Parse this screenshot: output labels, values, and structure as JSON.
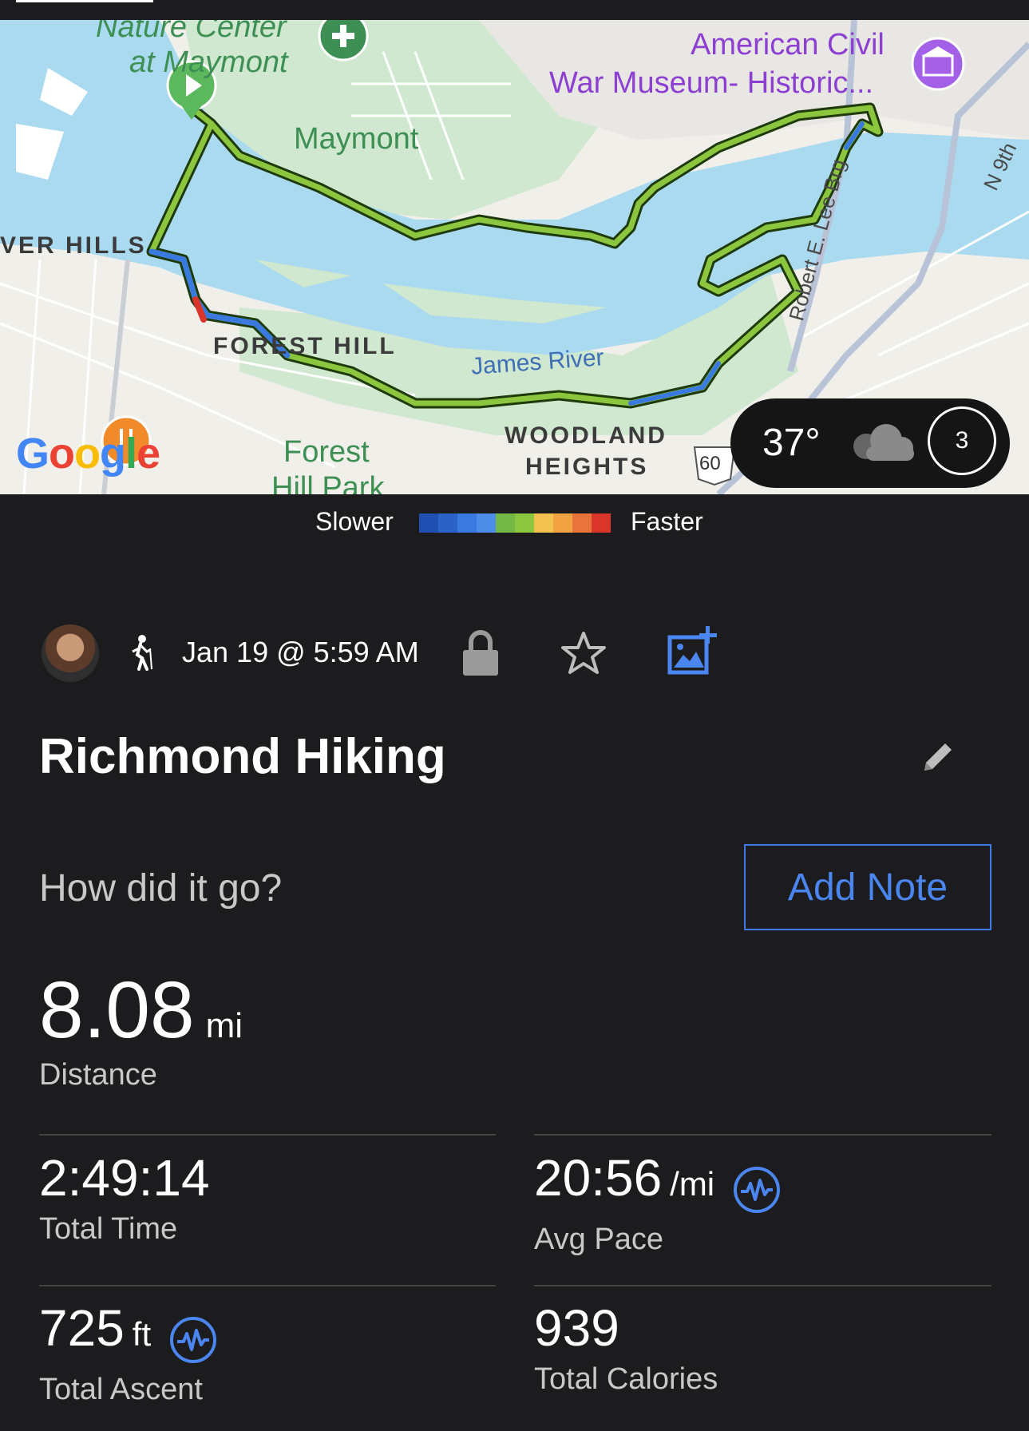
{
  "map": {
    "labels": {
      "nature_center_line1": "Nature Center",
      "nature_center_line2": "at Maymont",
      "maymont": "Maymont",
      "museum_line1": "American Civil",
      "museum_line2": "War Museum-  Historic...",
      "river_hills": "VER HILLS",
      "forest_hill": "FOREST HILL",
      "james_river": "James River",
      "woodland_line1": "WOODLAND",
      "woodland_line2": "HEIGHTS",
      "forest_hill_park_line1": "Forest",
      "forest_hill_park_line2": "Hill Park",
      "robert_e_lee_brg": "Robert E. Lee Brg",
      "n9th": "N 9th",
      "route_60": "60",
      "google": "Google"
    },
    "weather": {
      "temperature": "37°",
      "condition_icon": "cloud-icon",
      "uv_index": "3"
    }
  },
  "legend": {
    "slower": "Slower",
    "faster": "Faster",
    "colors": [
      "#1f4fb0",
      "#2a62c8",
      "#3a7ae0",
      "#4d8de8",
      "#74b845",
      "#8cc63f",
      "#f2c14e",
      "#f0a340",
      "#e8743b",
      "#d9352b"
    ]
  },
  "activity": {
    "activity_icon": "hiker-icon",
    "date": "Jan 19 @ 5:59 AM",
    "title": "Richmond Hiking",
    "prompt": "How did it go?",
    "add_note": "Add Note"
  },
  "stats": {
    "distance": {
      "value": "8.08",
      "unit": "mi",
      "label": "Distance"
    },
    "total_time": {
      "value": "2:49:14",
      "label": "Total Time"
    },
    "avg_pace": {
      "value": "20:56",
      "unit": "/mi",
      "label": "Avg Pace"
    },
    "total_ascent": {
      "value": "725",
      "unit": "ft",
      "label": "Total Ascent"
    },
    "total_calories": {
      "value": "939",
      "label": "Total Calories"
    }
  },
  "colors": {
    "accent_blue": "#3e7be8",
    "track_green": "#8cc63f",
    "background": "#1c1c1e"
  }
}
